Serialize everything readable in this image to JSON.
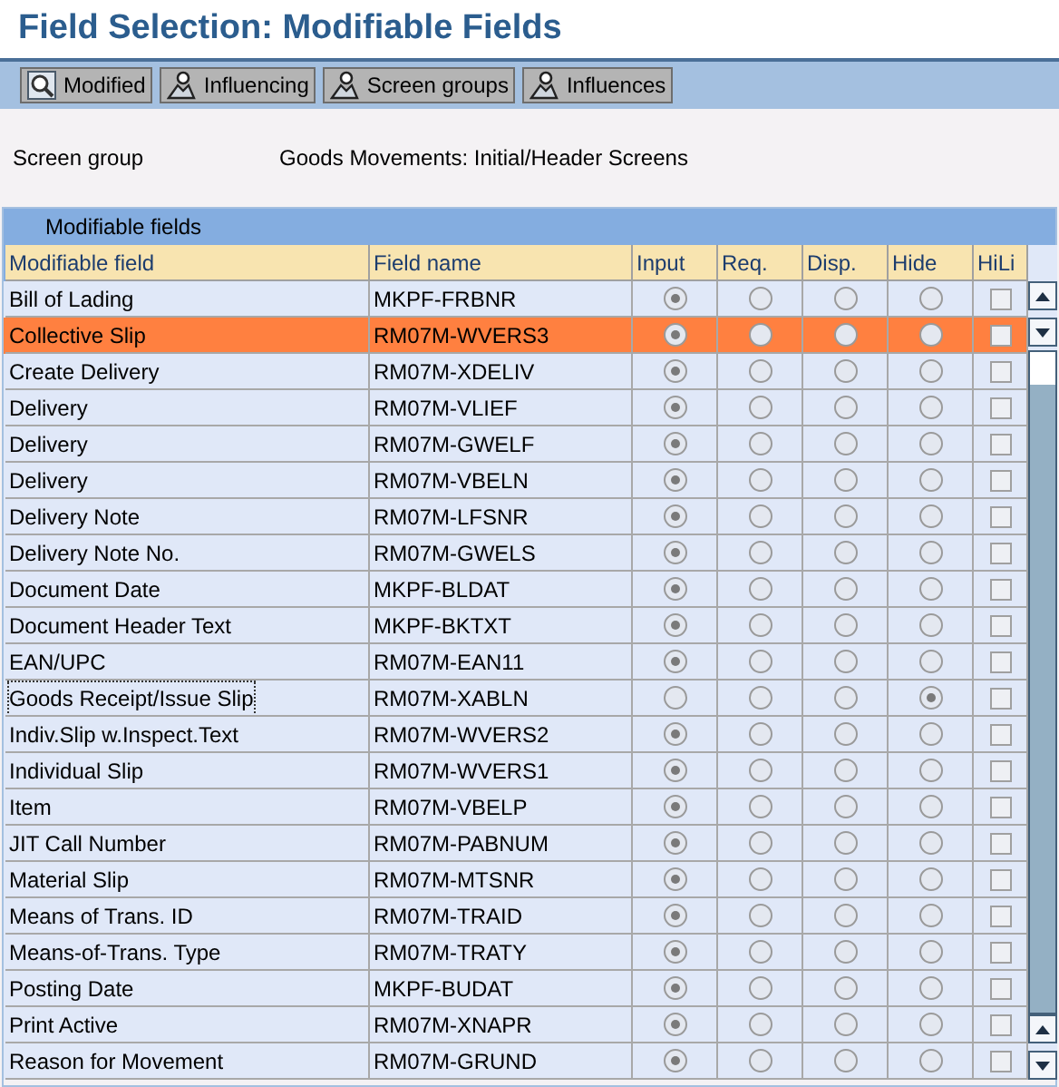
{
  "window": {
    "title": "Field Selection: Modifiable Fields"
  },
  "toolbar": [
    {
      "label": "Modified"
    },
    {
      "label": "Influencing"
    },
    {
      "label": "Screen groups"
    },
    {
      "label": "Influences"
    }
  ],
  "info": {
    "label": "Screen group",
    "value": "Goods Movements: Initial/Header Screens"
  },
  "table": {
    "title": "Modifiable fields",
    "columns": [
      {
        "label": "Modifiable field",
        "kind": "text"
      },
      {
        "label": "Field name",
        "kind": "text"
      },
      {
        "label": "Input",
        "kind": "radio"
      },
      {
        "label": "Req.",
        "kind": "radio"
      },
      {
        "label": "Disp.",
        "kind": "radio"
      },
      {
        "label": "Hide",
        "kind": "radio"
      },
      {
        "label": "HiLi",
        "kind": "check"
      }
    ],
    "rows": [
      {
        "field": "Bill of Lading",
        "name": "MKPF-FRBNR",
        "choices": [
          {
            "selected": true
          },
          {
            "selected": false
          },
          {
            "selected": false
          },
          {
            "selected": false
          }
        ],
        "hili": false,
        "selected": false
      },
      {
        "field": "Collective Slip",
        "name": "RM07M-WVERS3",
        "choices": [
          {
            "selected": true
          },
          {
            "selected": false
          },
          {
            "selected": false
          },
          {
            "selected": false
          }
        ],
        "hili": false,
        "selected": true
      },
      {
        "field": "Create Delivery",
        "name": "RM07M-XDELIV",
        "choices": [
          {
            "selected": true
          },
          {
            "selected": false
          },
          {
            "selected": false
          },
          {
            "selected": false
          }
        ],
        "hili": false,
        "selected": false
      },
      {
        "field": "Delivery",
        "name": "RM07M-VLIEF",
        "choices": [
          {
            "selected": true
          },
          {
            "selected": false
          },
          {
            "selected": false
          },
          {
            "selected": false
          }
        ],
        "hili": false,
        "selected": false
      },
      {
        "field": "Delivery",
        "name": "RM07M-GWELF",
        "choices": [
          {
            "selected": true
          },
          {
            "selected": false
          },
          {
            "selected": false
          },
          {
            "selected": false
          }
        ],
        "hili": false,
        "selected": false
      },
      {
        "field": "Delivery",
        "name": "RM07M-VBELN",
        "choices": [
          {
            "selected": true
          },
          {
            "selected": false
          },
          {
            "selected": false
          },
          {
            "selected": false
          }
        ],
        "hili": false,
        "selected": false
      },
      {
        "field": "Delivery Note",
        "name": "RM07M-LFSNR",
        "choices": [
          {
            "selected": true
          },
          {
            "selected": false
          },
          {
            "selected": false
          },
          {
            "selected": false
          }
        ],
        "hili": false,
        "selected": false
      },
      {
        "field": "Delivery Note No.",
        "name": "RM07M-GWELS",
        "choices": [
          {
            "selected": true
          },
          {
            "selected": false
          },
          {
            "selected": false
          },
          {
            "selected": false
          }
        ],
        "hili": false,
        "selected": false
      },
      {
        "field": "Document Date",
        "name": "MKPF-BLDAT",
        "choices": [
          {
            "selected": true
          },
          {
            "selected": false
          },
          {
            "selected": false
          },
          {
            "selected": false
          }
        ],
        "hili": false,
        "selected": false
      },
      {
        "field": "Document Header Text",
        "name": "MKPF-BKTXT",
        "choices": [
          {
            "selected": true
          },
          {
            "selected": false
          },
          {
            "selected": false
          },
          {
            "selected": false
          }
        ],
        "hili": false,
        "selected": false
      },
      {
        "field": "EAN/UPC",
        "name": "RM07M-EAN11",
        "choices": [
          {
            "selected": true
          },
          {
            "selected": false
          },
          {
            "selected": false
          },
          {
            "selected": false
          }
        ],
        "hili": false,
        "selected": false
      },
      {
        "field": "Goods Receipt/Issue Slip",
        "name": "RM07M-XABLN",
        "choices": [
          {
            "selected": false
          },
          {
            "selected": false
          },
          {
            "selected": false
          },
          {
            "selected": true
          }
        ],
        "hili": false,
        "selected": false,
        "focused": true
      },
      {
        "field": "Indiv.Slip w.Inspect.Text",
        "name": "RM07M-WVERS2",
        "choices": [
          {
            "selected": true
          },
          {
            "selected": false
          },
          {
            "selected": false
          },
          {
            "selected": false
          }
        ],
        "hili": false,
        "selected": false
      },
      {
        "field": "Individual Slip",
        "name": "RM07M-WVERS1",
        "choices": [
          {
            "selected": true
          },
          {
            "selected": false
          },
          {
            "selected": false
          },
          {
            "selected": false
          }
        ],
        "hili": false,
        "selected": false
      },
      {
        "field": "Item",
        "name": "RM07M-VBELP",
        "choices": [
          {
            "selected": true
          },
          {
            "selected": false
          },
          {
            "selected": false
          },
          {
            "selected": false
          }
        ],
        "hili": false,
        "selected": false
      },
      {
        "field": "JIT Call Number",
        "name": "RM07M-PABNUM",
        "choices": [
          {
            "selected": true
          },
          {
            "selected": false
          },
          {
            "selected": false
          },
          {
            "selected": false
          }
        ],
        "hili": false,
        "selected": false
      },
      {
        "field": "Material Slip",
        "name": "RM07M-MTSNR",
        "choices": [
          {
            "selected": true
          },
          {
            "selected": false
          },
          {
            "selected": false
          },
          {
            "selected": false
          }
        ],
        "hili": false,
        "selected": false
      },
      {
        "field": "Means of Trans. ID",
        "name": "RM07M-TRAID",
        "choices": [
          {
            "selected": true
          },
          {
            "selected": false
          },
          {
            "selected": false
          },
          {
            "selected": false
          }
        ],
        "hili": false,
        "selected": false
      },
      {
        "field": "Means-of-Trans. Type",
        "name": "RM07M-TRATY",
        "choices": [
          {
            "selected": true
          },
          {
            "selected": false
          },
          {
            "selected": false
          },
          {
            "selected": false
          }
        ],
        "hili": false,
        "selected": false
      },
      {
        "field": "Posting Date",
        "name": "MKPF-BUDAT",
        "choices": [
          {
            "selected": true
          },
          {
            "selected": false
          },
          {
            "selected": false
          },
          {
            "selected": false
          }
        ],
        "hili": false,
        "selected": false
      },
      {
        "field": "Print Active",
        "name": "RM07M-XNAPR",
        "choices": [
          {
            "selected": true
          },
          {
            "selected": false
          },
          {
            "selected": false
          },
          {
            "selected": false
          }
        ],
        "hili": false,
        "selected": false
      },
      {
        "field": "Reason for Movement",
        "name": "RM07M-GRUND",
        "choices": [
          {
            "selected": true
          },
          {
            "selected": false
          },
          {
            "selected": false
          },
          {
            "selected": false
          }
        ],
        "hili": false,
        "selected": false
      }
    ]
  }
}
